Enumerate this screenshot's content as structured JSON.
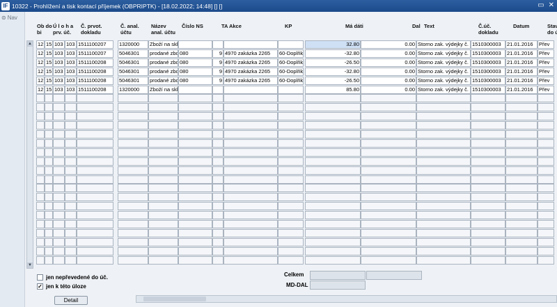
{
  "window": {
    "title": "10322 - Prohlížení a tisk kontací příjemek (OBPRIPTK) - [18.02.2022; 14:48] [] []",
    "app_icon": "IF"
  },
  "leftnav": {
    "label": "Nav"
  },
  "columns": [
    "Ob do bi",
    "Ú l o h a prv. úč.",
    "Č. prvot. dokladu",
    "Č. anal. účtu",
    "Název anal. účtu",
    "Číslo NS",
    "TA Akce",
    "KP",
    "Má dáti",
    "Dal",
    "Text",
    "Č.úč. dokladu",
    "Datum",
    "Stav do ú"
  ],
  "headers": {
    "obdobi": "Ob do\nbi",
    "uloha": "Ú l o h a\nprv. úč.",
    "prvot": "Č. prvot.\ndokladu",
    "anal": "Č. anal.\núčtu",
    "nazev": "Název\nanal. účtu",
    "ns": "Číslo NS",
    "ta": "TA Akce",
    "kp": "KP",
    "madati": "Má dáti",
    "dal": "Dal",
    "text": "Text",
    "ucdok": "Č.úč.\ndokladu",
    "datum": "Datum",
    "stav": "Stav\ndo ú"
  },
  "rows": [
    {
      "ob": "12",
      "u1": "15",
      "u2": "103",
      "u3": "103",
      "prvot": "1511100207",
      "anal": "1320000",
      "nazev": "Zboží na skl",
      "ns": "",
      "ta": "",
      "akce": "",
      "kp": "",
      "madati": "32.80",
      "dal": "0.00",
      "text": "Storno zak. výdejky č.",
      "ucdok": "1510300003",
      "datum": "21.01.2016",
      "stav": "Přev"
    },
    {
      "ob": "12",
      "u1": "15",
      "u2": "103",
      "u3": "103",
      "prvot": "1511100207",
      "anal": "5046301",
      "nazev": "prodané zbo",
      "ns": "080",
      "ta": "9",
      "akce": "4970 zakázka 2265",
      "kp": "60-Doplňk",
      "madati": "-32.80",
      "dal": "0.00",
      "text": "Storno zak. výdejky č.",
      "ucdok": "1510300003",
      "datum": "21.01.2016",
      "stav": "Přev"
    },
    {
      "ob": "12",
      "u1": "15",
      "u2": "103",
      "u3": "103",
      "prvot": "1511100208",
      "anal": "5046301",
      "nazev": "prodané zbo",
      "ns": "080",
      "ta": "9",
      "akce": "4970 zakázka 2265",
      "kp": "60-Doplňk",
      "madati": "-26.50",
      "dal": "0.00",
      "text": "Storno zak. výdejky č.",
      "ucdok": "1510300003",
      "datum": "21.01.2016",
      "stav": "Přev"
    },
    {
      "ob": "12",
      "u1": "15",
      "u2": "103",
      "u3": "103",
      "prvot": "1511100208",
      "anal": "5046301",
      "nazev": "prodané zbo",
      "ns": "080",
      "ta": "9",
      "akce": "4970 zakázka 2265",
      "kp": "60-Doplňk",
      "madati": "-32.80",
      "dal": "0.00",
      "text": "Storno zak. výdejky č.",
      "ucdok": "1510300003",
      "datum": "21.01.2016",
      "stav": "Přev"
    },
    {
      "ob": "12",
      "u1": "15",
      "u2": "103",
      "u3": "103",
      "prvot": "1511100208",
      "anal": "5046301",
      "nazev": "prodané zbo",
      "ns": "080",
      "ta": "9",
      "akce": "4970 zakázka 2265",
      "kp": "60-Doplňk",
      "madati": "-26.50",
      "dal": "0.00",
      "text": "Storno zak. výdejky č.",
      "ucdok": "1510300003",
      "datum": "21.01.2016",
      "stav": "Přev"
    },
    {
      "ob": "12",
      "u1": "15",
      "u2": "103",
      "u3": "103",
      "prvot": "1511100208",
      "anal": "1320000",
      "nazev": "Zboží na skl",
      "ns": "",
      "ta": "",
      "akce": "",
      "kp": "",
      "madati": "85.80",
      "dal": "0.00",
      "text": "Storno zak. výdejky č.",
      "ucdok": "1510300003",
      "datum": "21.01.2016",
      "stav": "Přev"
    }
  ],
  "filters": {
    "neprevedene": {
      "label": "jen nepřevedené do úč.",
      "checked": false
    },
    "uloha": {
      "label": "jen k této úloze",
      "checked": true
    }
  },
  "buttons": {
    "detail": "Detail"
  },
  "summary": {
    "celkem": "Celkem",
    "mddal": "MD-DAL"
  }
}
